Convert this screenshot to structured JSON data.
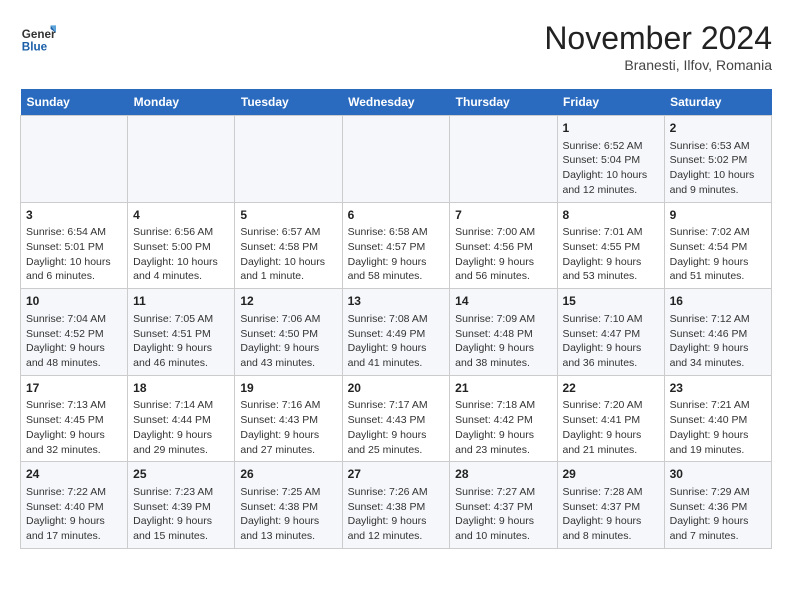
{
  "logo": {
    "general": "General",
    "blue": "Blue"
  },
  "title": "November 2024",
  "location": "Branesti, Ilfov, Romania",
  "days_of_week": [
    "Sunday",
    "Monday",
    "Tuesday",
    "Wednesday",
    "Thursday",
    "Friday",
    "Saturday"
  ],
  "weeks": [
    [
      {
        "day": "",
        "info": ""
      },
      {
        "day": "",
        "info": ""
      },
      {
        "day": "",
        "info": ""
      },
      {
        "day": "",
        "info": ""
      },
      {
        "day": "",
        "info": ""
      },
      {
        "day": "1",
        "info": "Sunrise: 6:52 AM\nSunset: 5:04 PM\nDaylight: 10 hours and 12 minutes."
      },
      {
        "day": "2",
        "info": "Sunrise: 6:53 AM\nSunset: 5:02 PM\nDaylight: 10 hours and 9 minutes."
      }
    ],
    [
      {
        "day": "3",
        "info": "Sunrise: 6:54 AM\nSunset: 5:01 PM\nDaylight: 10 hours and 6 minutes."
      },
      {
        "day": "4",
        "info": "Sunrise: 6:56 AM\nSunset: 5:00 PM\nDaylight: 10 hours and 4 minutes."
      },
      {
        "day": "5",
        "info": "Sunrise: 6:57 AM\nSunset: 4:58 PM\nDaylight: 10 hours and 1 minute."
      },
      {
        "day": "6",
        "info": "Sunrise: 6:58 AM\nSunset: 4:57 PM\nDaylight: 9 hours and 58 minutes."
      },
      {
        "day": "7",
        "info": "Sunrise: 7:00 AM\nSunset: 4:56 PM\nDaylight: 9 hours and 56 minutes."
      },
      {
        "day": "8",
        "info": "Sunrise: 7:01 AM\nSunset: 4:55 PM\nDaylight: 9 hours and 53 minutes."
      },
      {
        "day": "9",
        "info": "Sunrise: 7:02 AM\nSunset: 4:54 PM\nDaylight: 9 hours and 51 minutes."
      }
    ],
    [
      {
        "day": "10",
        "info": "Sunrise: 7:04 AM\nSunset: 4:52 PM\nDaylight: 9 hours and 48 minutes."
      },
      {
        "day": "11",
        "info": "Sunrise: 7:05 AM\nSunset: 4:51 PM\nDaylight: 9 hours and 46 minutes."
      },
      {
        "day": "12",
        "info": "Sunrise: 7:06 AM\nSunset: 4:50 PM\nDaylight: 9 hours and 43 minutes."
      },
      {
        "day": "13",
        "info": "Sunrise: 7:08 AM\nSunset: 4:49 PM\nDaylight: 9 hours and 41 minutes."
      },
      {
        "day": "14",
        "info": "Sunrise: 7:09 AM\nSunset: 4:48 PM\nDaylight: 9 hours and 38 minutes."
      },
      {
        "day": "15",
        "info": "Sunrise: 7:10 AM\nSunset: 4:47 PM\nDaylight: 9 hours and 36 minutes."
      },
      {
        "day": "16",
        "info": "Sunrise: 7:12 AM\nSunset: 4:46 PM\nDaylight: 9 hours and 34 minutes."
      }
    ],
    [
      {
        "day": "17",
        "info": "Sunrise: 7:13 AM\nSunset: 4:45 PM\nDaylight: 9 hours and 32 minutes."
      },
      {
        "day": "18",
        "info": "Sunrise: 7:14 AM\nSunset: 4:44 PM\nDaylight: 9 hours and 29 minutes."
      },
      {
        "day": "19",
        "info": "Sunrise: 7:16 AM\nSunset: 4:43 PM\nDaylight: 9 hours and 27 minutes."
      },
      {
        "day": "20",
        "info": "Sunrise: 7:17 AM\nSunset: 4:43 PM\nDaylight: 9 hours and 25 minutes."
      },
      {
        "day": "21",
        "info": "Sunrise: 7:18 AM\nSunset: 4:42 PM\nDaylight: 9 hours and 23 minutes."
      },
      {
        "day": "22",
        "info": "Sunrise: 7:20 AM\nSunset: 4:41 PM\nDaylight: 9 hours and 21 minutes."
      },
      {
        "day": "23",
        "info": "Sunrise: 7:21 AM\nSunset: 4:40 PM\nDaylight: 9 hours and 19 minutes."
      }
    ],
    [
      {
        "day": "24",
        "info": "Sunrise: 7:22 AM\nSunset: 4:40 PM\nDaylight: 9 hours and 17 minutes."
      },
      {
        "day": "25",
        "info": "Sunrise: 7:23 AM\nSunset: 4:39 PM\nDaylight: 9 hours and 15 minutes."
      },
      {
        "day": "26",
        "info": "Sunrise: 7:25 AM\nSunset: 4:38 PM\nDaylight: 9 hours and 13 minutes."
      },
      {
        "day": "27",
        "info": "Sunrise: 7:26 AM\nSunset: 4:38 PM\nDaylight: 9 hours and 12 minutes."
      },
      {
        "day": "28",
        "info": "Sunrise: 7:27 AM\nSunset: 4:37 PM\nDaylight: 9 hours and 10 minutes."
      },
      {
        "day": "29",
        "info": "Sunrise: 7:28 AM\nSunset: 4:37 PM\nDaylight: 9 hours and 8 minutes."
      },
      {
        "day": "30",
        "info": "Sunrise: 7:29 AM\nSunset: 4:36 PM\nDaylight: 9 hours and 7 minutes."
      }
    ]
  ]
}
